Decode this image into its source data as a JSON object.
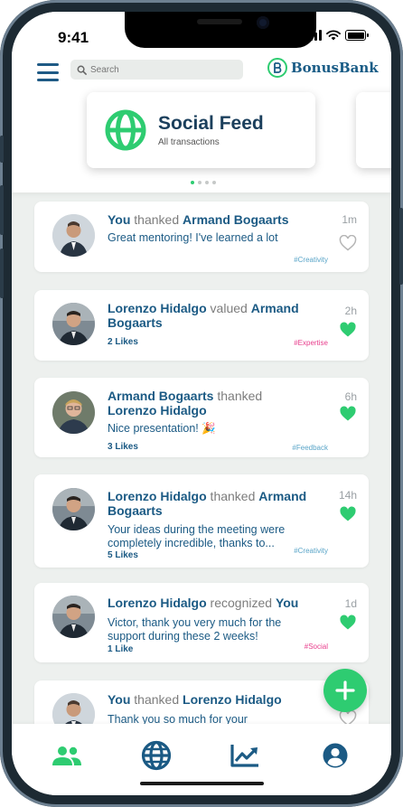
{
  "status_bar": {
    "time": "9:41"
  },
  "header": {
    "search": {
      "placeholder": "Search"
    },
    "logo_text": "BonusBank"
  },
  "hero": {
    "title": "Social Feed",
    "subtitle": "All transactions",
    "icon": "globe-icon",
    "page_indicator": {
      "count": 4,
      "active_index": 0
    }
  },
  "colors": {
    "primary_blue": "#1b5a84",
    "green": "#2ecc71",
    "tag_blue": "#5aa5c8",
    "tag_pink": "#e83e8c"
  },
  "feed": [
    {
      "actor": "You",
      "verb": " thanked ",
      "target": "Armand Bogaarts",
      "message": "Great mentoring! I've learned a lot",
      "likes": "",
      "time": "1m",
      "tag": "#Creativity",
      "liked": false
    },
    {
      "actor": "Lorenzo Hidalgo",
      "verb": " valued ",
      "target": "Armand Bogaarts",
      "message": "",
      "likes": "2 Likes",
      "time": "2h",
      "tag": "#Expertise",
      "liked": true
    },
    {
      "actor": "Armand Bogaarts",
      "verb": " thanked ",
      "target": "Lorenzo Hidalgo",
      "message": "Nice presentation! 🎉",
      "likes": "3 Likes",
      "time": "6h",
      "tag": "#Feedback",
      "liked": true
    },
    {
      "actor": "Lorenzo Hidalgo",
      "verb": " thanked ",
      "target": "Armand Bogaarts",
      "message": "Your ideas during the meeting were completely incredible, thanks to...",
      "likes": "5 Likes",
      "time": "14h",
      "tag": "#Creativity",
      "liked": true
    },
    {
      "actor": "Lorenzo Hidalgo",
      "verb": " recognized ",
      "target": "You",
      "message": "Victor, thank you very much for the support during these 2 weeks!",
      "likes": "1 Like",
      "time": "1d",
      "tag": "#Social",
      "liked": true
    },
    {
      "actor": "You",
      "verb": " thanked ",
      "target": "Lorenzo Hidalgo",
      "message": "Thank you so much for your",
      "likes": "",
      "time": "",
      "tag": "",
      "liked": false
    }
  ],
  "tabbar": {
    "tabs": [
      "people-icon",
      "globe-icon",
      "trending-chart-icon",
      "account-icon"
    ]
  }
}
